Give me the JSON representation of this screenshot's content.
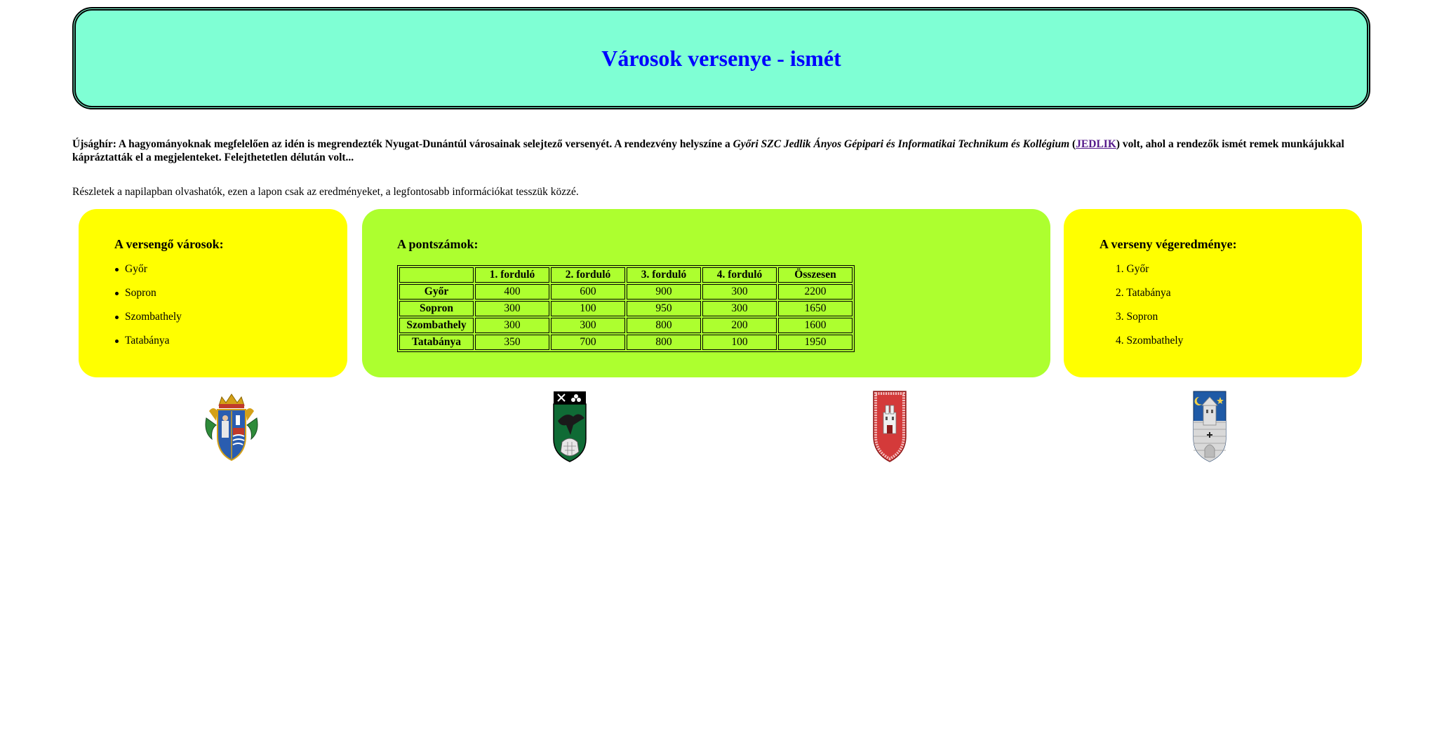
{
  "header": {
    "title": "Városok versenye - ismét"
  },
  "intro": {
    "lead": "Újsághír: A hagyományoknak megfelelően az idén is megrendezték Nyugat-Dunántúl városainak selejtező versenyét. A rendezvény helyszíne a ",
    "venue": "Győri SZC Jedlik Ányos Gépipari és Informatikai Technikum és Kollégium",
    "paren_open": " (",
    "link": "JEDLIK",
    "rest": ") volt, ahol a rendezők ismét remek munkájukkal kápráztatták el a megjelenteket. Felejthetetlen délután volt..."
  },
  "details": "Részletek a napilapban olvashatók, ezen a lapon csak az eredményeket, a legfontosabb információkat tesszük közzé.",
  "cities": {
    "title": "A versengő városok:",
    "items": [
      "Győr",
      "Sopron",
      "Szombathely",
      "Tatabánya"
    ]
  },
  "points": {
    "title": "A pontszámok:",
    "headers": [
      "",
      "1. forduló",
      "2. forduló",
      "3. forduló",
      "4. forduló",
      "Összesen"
    ],
    "rows": [
      {
        "city": "Győr",
        "values": [
          "400",
          "600",
          "900",
          "300",
          "2200"
        ]
      },
      {
        "city": "Sopron",
        "values": [
          "300",
          "100",
          "950",
          "300",
          "1650"
        ]
      },
      {
        "city": "Szombathely",
        "values": [
          "300",
          "300",
          "800",
          "200",
          "1600"
        ]
      },
      {
        "city": "Tatabánya",
        "values": [
          "350",
          "700",
          "800",
          "100",
          "1950"
        ]
      }
    ]
  },
  "results": {
    "title": "A verseny végeredménye:",
    "items": [
      "1. Győr",
      "2. Tatabánya",
      "3. Sopron",
      "4. Szombathely"
    ]
  },
  "crests": [
    {
      "icon": "gyor-coat-of-arms-icon"
    },
    {
      "icon": "tatabanya-coat-of-arms-icon"
    },
    {
      "icon": "sopron-coat-of-arms-icon"
    },
    {
      "icon": "szombathely-coat-of-arms-icon"
    }
  ],
  "colors": {
    "header_bg": "#7fffd4",
    "title": "#0000ff",
    "box_yellow": "#ffff00",
    "box_green": "#adff2f"
  }
}
